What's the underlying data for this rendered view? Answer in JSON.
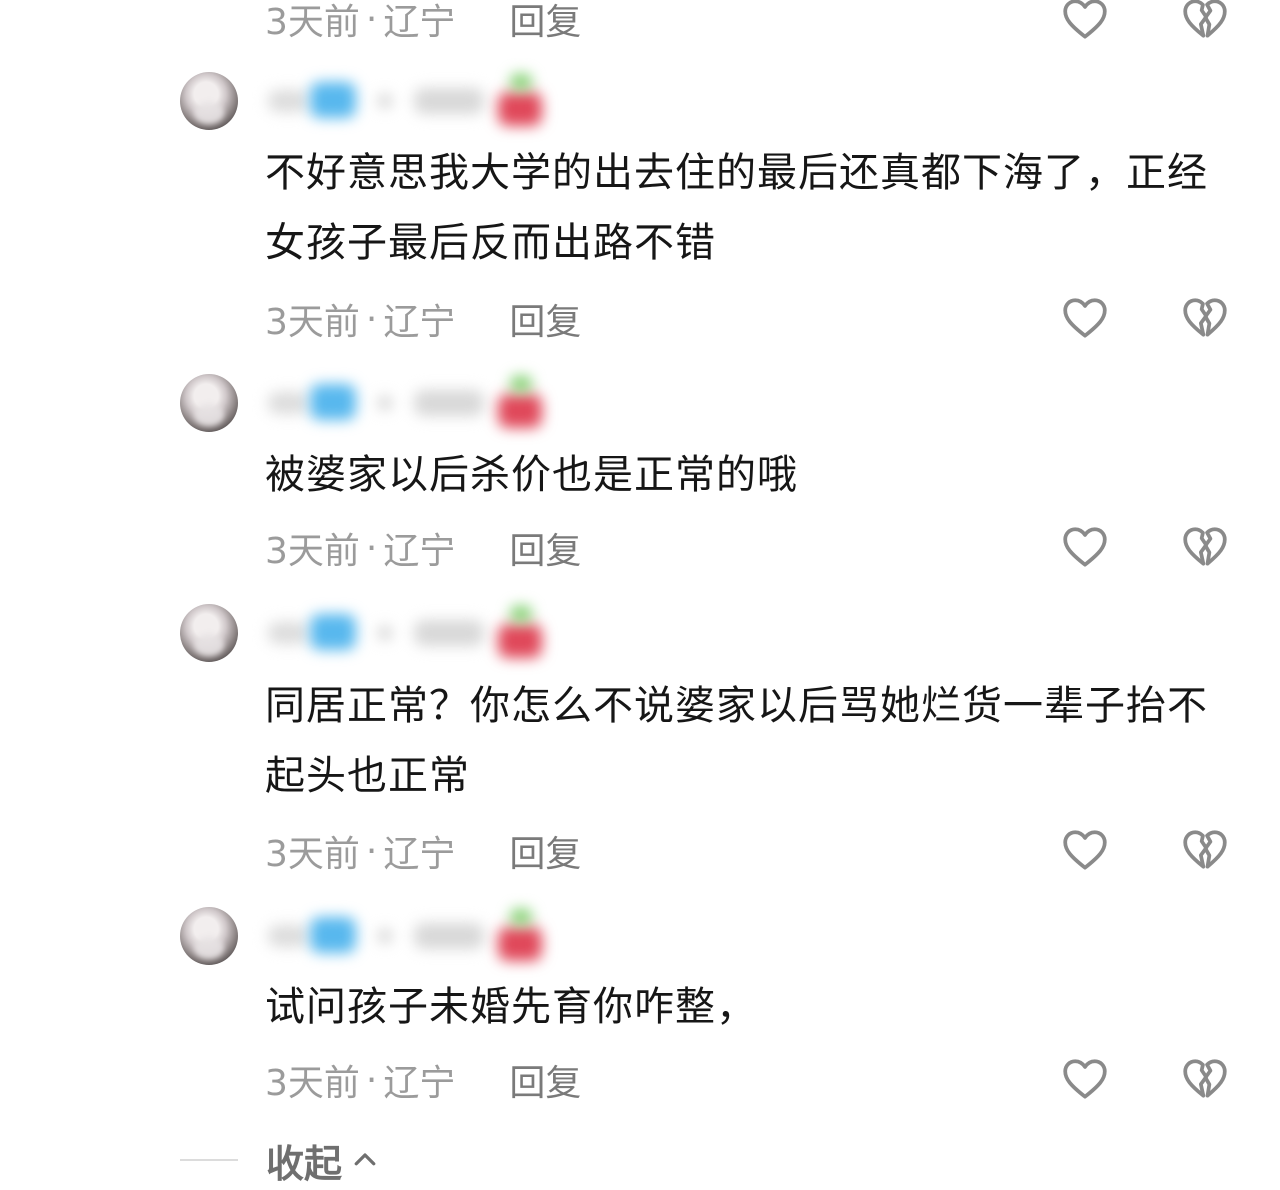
{
  "comments": [
    {
      "text": "",
      "time": "3天前",
      "separator": "·",
      "location": "辽宁",
      "reply_label": "回复",
      "like_icon": "heart-outline-icon",
      "dislike_icon": "broken-heart-icon"
    },
    {
      "text": "不好意思我大学的出去住的最后还真都下海了，正经女孩子最后反而出路不错",
      "time": "3天前",
      "separator": "·",
      "location": "辽宁",
      "reply_label": "回复",
      "like_icon": "heart-outline-icon",
      "dislike_icon": "broken-heart-icon"
    },
    {
      "text": "被婆家以后杀价也是正常的哦",
      "time": "3天前",
      "separator": "·",
      "location": "辽宁",
      "reply_label": "回复",
      "like_icon": "heart-outline-icon",
      "dislike_icon": "broken-heart-icon"
    },
    {
      "text": "同居正常？你怎么不说婆家以后骂她烂货一辈子抬不起头也正常",
      "time": "3天前",
      "separator": "·",
      "location": "辽宁",
      "reply_label": "回复",
      "like_icon": "heart-outline-icon",
      "dislike_icon": "broken-heart-icon"
    },
    {
      "text": "试问孩子未婚先育你咋整，",
      "time": "3天前",
      "separator": "·",
      "location": "辽宁",
      "reply_label": "回复",
      "like_icon": "heart-outline-icon",
      "dislike_icon": "broken-heart-icon"
    }
  ],
  "collapse_label": "收起",
  "colors": {
    "text": "#161616",
    "meta": "#9b9b9b",
    "icon": "#8a8a8a",
    "blur_blue": "#58b8ee",
    "blur_red": "#e0485a",
    "blur_green": "#7ccf6a"
  }
}
